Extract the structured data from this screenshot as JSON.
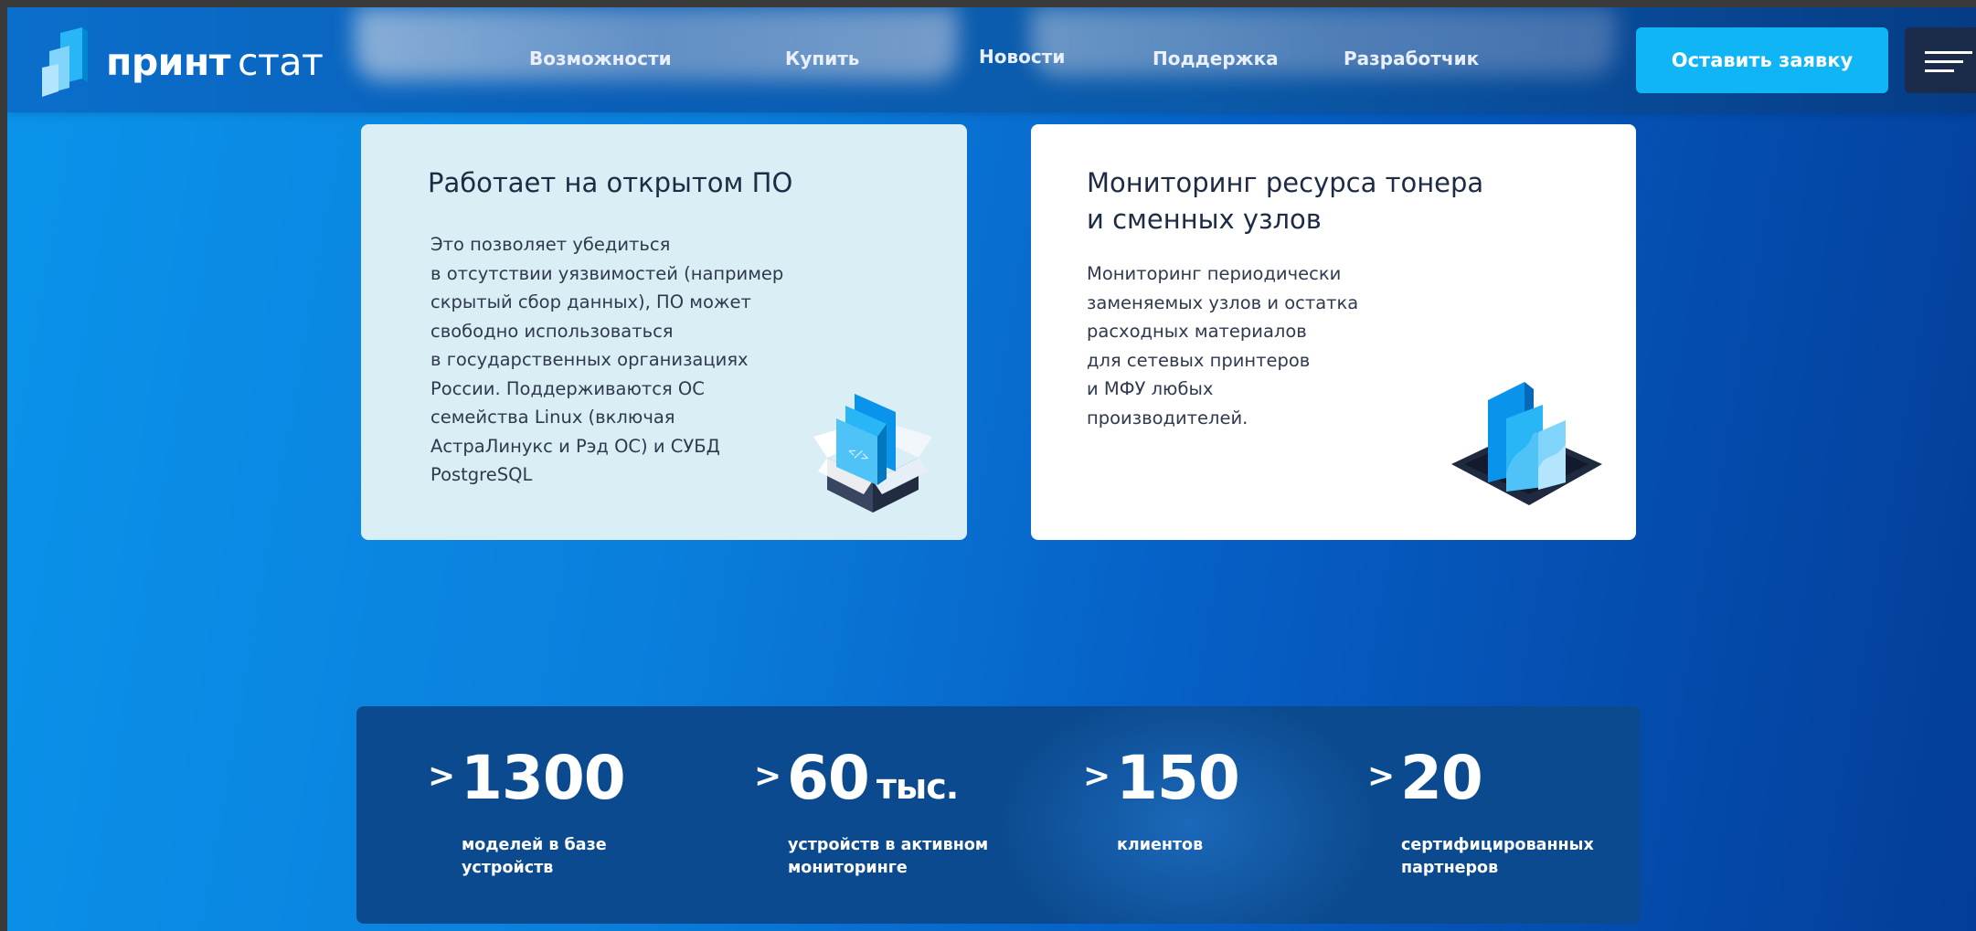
{
  "brand": {
    "name_bold": "принт",
    "name_light": "стат"
  },
  "nav": [
    {
      "label": "Возможности"
    },
    {
      "label": "Купить"
    },
    {
      "label": "Новости"
    },
    {
      "label": "Поддержка"
    },
    {
      "label": "Разработчик"
    }
  ],
  "cta_label": "Оставить заявку",
  "cards": [
    {
      "title_lines": [
        "Работает на открытом ПО"
      ],
      "text_lines": [
        "Это позволяет убедиться",
        "в отсутствии уязвимостей (например",
        "скрытый сбор данных), ПО может",
        "свободно использоваться",
        "в государственных организациях",
        "России. Поддерживаются ОС",
        "семейства Linux (включая",
        "АстраЛинукс и Рэд ОС) и СУБД",
        "PostgreSQL"
      ],
      "icon": "open-box-code-icon"
    },
    {
      "title_lines": [
        "Мониторинг ресурса тонера",
        "и сменных узлов"
      ],
      "text_lines": [
        "Мониторинг периодически",
        "заменяемых узлов и остатка",
        "расходных материалов",
        "для сетевых принтеров",
        "и МФУ любых",
        "производителей."
      ],
      "icon": "chart-monitoring-icon"
    }
  ],
  "stats": [
    {
      "prefix": ">",
      "value": "1300",
      "unit": "",
      "label_lines": [
        "моделей в базе",
        "устройств"
      ]
    },
    {
      "prefix": ">",
      "value": "60",
      "unit": "тыс.",
      "label_lines": [
        "устройств в активном",
        "мониторинге"
      ]
    },
    {
      "prefix": ">",
      "value": "150",
      "unit": "",
      "label_lines": [
        "клиентов"
      ]
    },
    {
      "prefix": ">",
      "value": "20",
      "unit": "",
      "label_lines": [
        "сертифицированных",
        "партнеров"
      ]
    }
  ],
  "colors": {
    "cta": "#10b5f6",
    "card_left_bg": "#d9eef5",
    "card_right_bg": "#ffffff",
    "stats_bg": "#0b4a8f",
    "menu_bg": "#1b2b4a"
  }
}
